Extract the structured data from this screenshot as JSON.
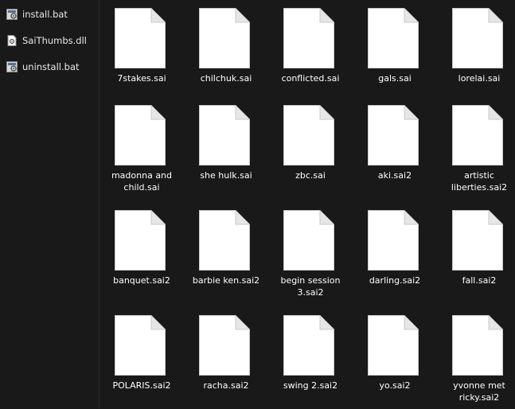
{
  "left_files": [
    {
      "name": "install.bat",
      "icon": "batch-file-icon"
    },
    {
      "name": "SaiThumbs.dll",
      "icon": "dll-file-icon"
    },
    {
      "name": "uninstall.bat",
      "icon": "batch-file-icon"
    }
  ],
  "files": [
    {
      "name": "7stakes.sai"
    },
    {
      "name": "chilchuk.sai"
    },
    {
      "name": "conflicted.sai"
    },
    {
      "name": "gals.sai"
    },
    {
      "name": "lorelai.sai"
    },
    {
      "name": "madonna and child.sai"
    },
    {
      "name": "she hulk.sai"
    },
    {
      "name": "zbc.sai"
    },
    {
      "name": "aki.sai2"
    },
    {
      "name": "artistic liberties.sai2"
    },
    {
      "name": "banquet.sai2"
    },
    {
      "name": "barbie ken.sai2"
    },
    {
      "name": "begin session 3.sai2"
    },
    {
      "name": "darling.sai2"
    },
    {
      "name": "fall.sai2"
    },
    {
      "name": "POLARIS.sai2"
    },
    {
      "name": "racha.sai2"
    },
    {
      "name": "swing 2.sai2"
    },
    {
      "name": "yo.sai2"
    },
    {
      "name": "yvonne met ricky.sai2"
    }
  ],
  "colors": {
    "background": "#191919",
    "document_icon": "#ffffff"
  }
}
